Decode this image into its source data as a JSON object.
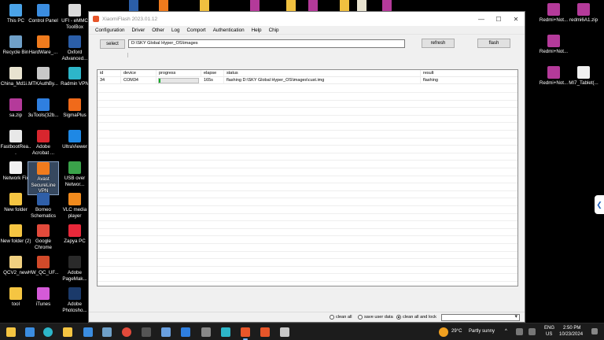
{
  "desktop": {
    "icons": [
      {
        "label": "This PC",
        "color": "#4aa3e8"
      },
      {
        "label": "Control Panel",
        "color": "#3b8de0"
      },
      {
        "label": "UFI - eMMC ToolBox",
        "color": "#d9d9d9"
      },
      {
        "label": "Recycle Bin",
        "color": "#6fa0c8"
      },
      {
        "label": "HardWare_...",
        "color": "#f07b1d"
      },
      {
        "label": "Oxford Advanced...",
        "color": "#2b5ea8"
      },
      {
        "label": "China_Md1i...",
        "color": "#e8e3d0"
      },
      {
        "label": "MTKAuthBy...",
        "color": "#c8c8c8"
      },
      {
        "label": "Radmin VPN",
        "color": "#2db6c9"
      },
      {
        "label": "sa.zip",
        "color": "#b43a9a"
      },
      {
        "label": "3uTools(32b...",
        "color": "#2f7fe0"
      },
      {
        "label": "SigmaPlus",
        "color": "#f06a1a"
      },
      {
        "label": "FastbootRea...",
        "color": "#e8e8e8"
      },
      {
        "label": "Adobe Acrobat ...",
        "color": "#d8262e"
      },
      {
        "label": "UltraViewer",
        "color": "#1e88e5"
      },
      {
        "label": "Network Fix",
        "color": "#f0f0f0"
      },
      {
        "label": "Avast SecureLine VPN",
        "color": "#f07b1d"
      },
      {
        "label": "USB over Networ...",
        "color": "#3aa34a"
      },
      {
        "label": "New folder",
        "color": "#f5c542"
      },
      {
        "label": "Borneo Schematics",
        "color": "#2f5fa8"
      },
      {
        "label": "VLC media player",
        "color": "#f08a1d"
      },
      {
        "label": "New folder (2)",
        "color": "#f5c542"
      },
      {
        "label": "Google Chrome",
        "color": "#e24a3b"
      },
      {
        "label": "Zapya PC",
        "color": "#e8283a"
      },
      {
        "label": "QCV2_new",
        "color": "#f0d080"
      },
      {
        "label": "HW_QC_UF...",
        "color": "#d24a2a"
      },
      {
        "label": "Adobe PageMak...",
        "color": "#2a2a2a"
      },
      {
        "label": "tool",
        "color": "#f5c542"
      },
      {
        "label": "iTunes",
        "color": "#d55ad8"
      },
      {
        "label": "Adobe Photosho...",
        "color": "#1b3a6a"
      }
    ],
    "right_icons": [
      {
        "label": "Redmi+Not...",
        "color": "#b43a9a"
      },
      {
        "label": "redmi6A1.zip",
        "color": "#b43a9a"
      },
      {
        "label": "Redmi+Not...",
        "color": "#b43a9a"
      },
      {
        "label": "Redmi+Not...",
        "color": "#b43a9a"
      },
      {
        "label": "MI7_Tablet(...",
        "color": "#f0f0f0"
      }
    ]
  },
  "window": {
    "title": "XiaomiFlash 2023.01.12",
    "controls": {
      "minimize": "—",
      "maximize": "☐",
      "close": "✕"
    },
    "menu": [
      "Configuration",
      "Driver",
      "Other",
      "Log",
      "Comport",
      "Authentication",
      "Help",
      "Chip"
    ],
    "toolbar": {
      "select_label": "select",
      "path_value": "D:\\SKY Global Hyper_OS\\images",
      "refresh_label": "refresh",
      "flash_label": "flash"
    },
    "grid": {
      "headers": [
        "id",
        "device",
        "progress",
        "elapse",
        "status",
        "result"
      ],
      "rows": [
        {
          "id": "34",
          "device": "COM34",
          "progress": 0.04,
          "elapse": "165s",
          "status": "flashing D:\\SKY Global Hyper_OS\\images\\cust.img",
          "result": "flashing",
          "progress_color": "#06b025"
        }
      ]
    },
    "status": {
      "options": [
        "clean all",
        "save user data",
        "clean all and lock"
      ],
      "selected": 2
    }
  },
  "taskbar": {
    "weather_temp": "29°C",
    "weather_text": "Partly sunny",
    "lang_top": "ENG",
    "lang_bottom": "US",
    "time": "2:50 PM",
    "date": "10/23/2024",
    "side_tab_glyph": "❮"
  }
}
